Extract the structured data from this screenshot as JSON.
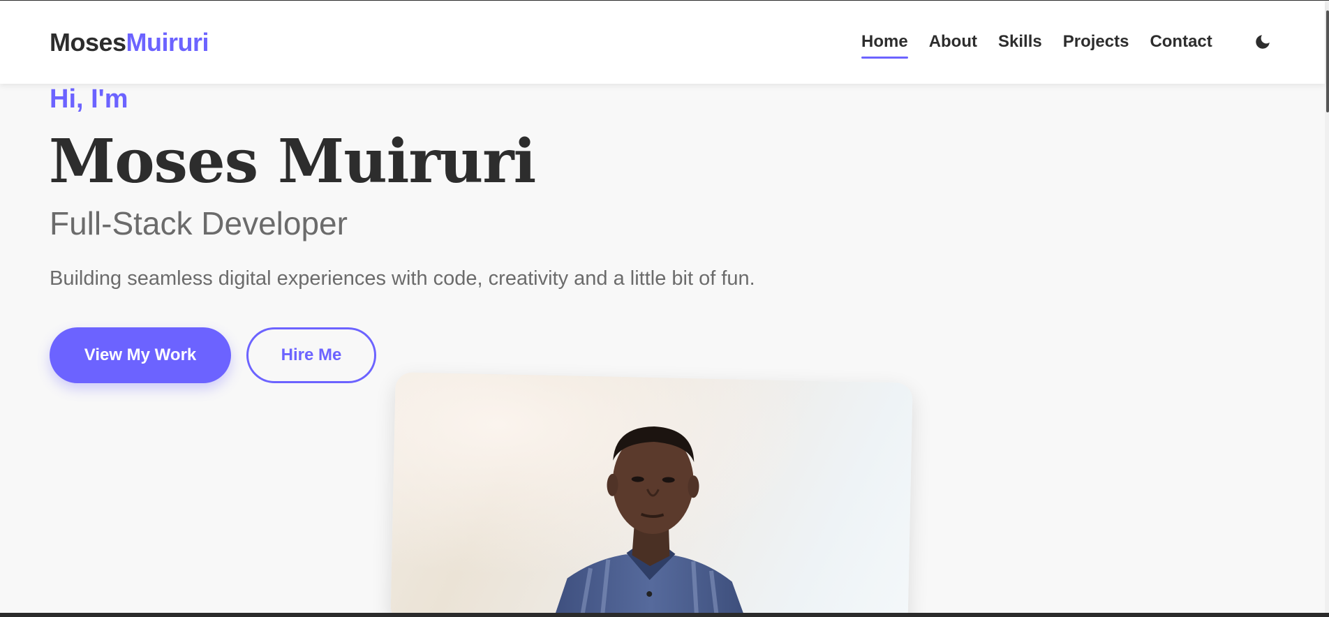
{
  "header": {
    "logo_first": "Moses",
    "logo_second": "Muiruri",
    "nav": [
      {
        "label": "Home",
        "active": true
      },
      {
        "label": "About",
        "active": false
      },
      {
        "label": "Skills",
        "active": false
      },
      {
        "label": "Projects",
        "active": false
      },
      {
        "label": "Contact",
        "active": false
      }
    ],
    "theme_toggle_icon": "moon-icon"
  },
  "hero": {
    "greeting": "Hi, I'm",
    "name": "Moses Muiruri",
    "role": "Full-Stack Developer",
    "tagline": "Building seamless digital experiences with code, creativity and a little bit of fun.",
    "primary_button": "View My Work",
    "secondary_button": "Hire Me",
    "photo_icon": "profile-photo"
  },
  "colors": {
    "accent": "#6c63ff",
    "text_dark": "#2d2d2d",
    "text_muted": "#6b6b6b",
    "background": "#f8f8f8"
  }
}
